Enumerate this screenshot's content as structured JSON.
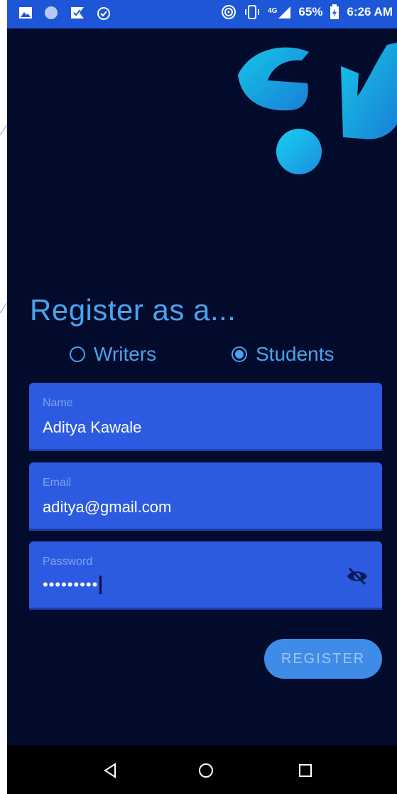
{
  "status_bar": {
    "battery": "65%",
    "time": "6:26 AM",
    "network": "4G",
    "icons": [
      "image-icon",
      "circle-icon",
      "flag-check-icon",
      "clock-check-icon",
      "hotspot-icon",
      "vibrate-icon",
      "signal-icon",
      "battery-icon"
    ]
  },
  "colors": {
    "background": "#020b2b",
    "status_bar": "#1e56d8",
    "field": "#2c5be1",
    "accent": "#4aa3f0",
    "button": "#3f8ce8",
    "logo_primary": "#19b0e0"
  },
  "form": {
    "title": "Register as a...",
    "role_options": [
      {
        "label": "Writers",
        "selected": false
      },
      {
        "label": "Students",
        "selected": true
      }
    ],
    "name": {
      "label": "Name",
      "value": "Aditya Kawale"
    },
    "email": {
      "label": "Email",
      "value": "aditya@gmail.com"
    },
    "password": {
      "label": "Password",
      "value": "•••••••••",
      "visibility_icon": "eye-off-icon"
    },
    "register_label": "REGISTER"
  },
  "nav_bar": {
    "icons": [
      "back-icon",
      "home-icon",
      "recents-icon"
    ]
  }
}
